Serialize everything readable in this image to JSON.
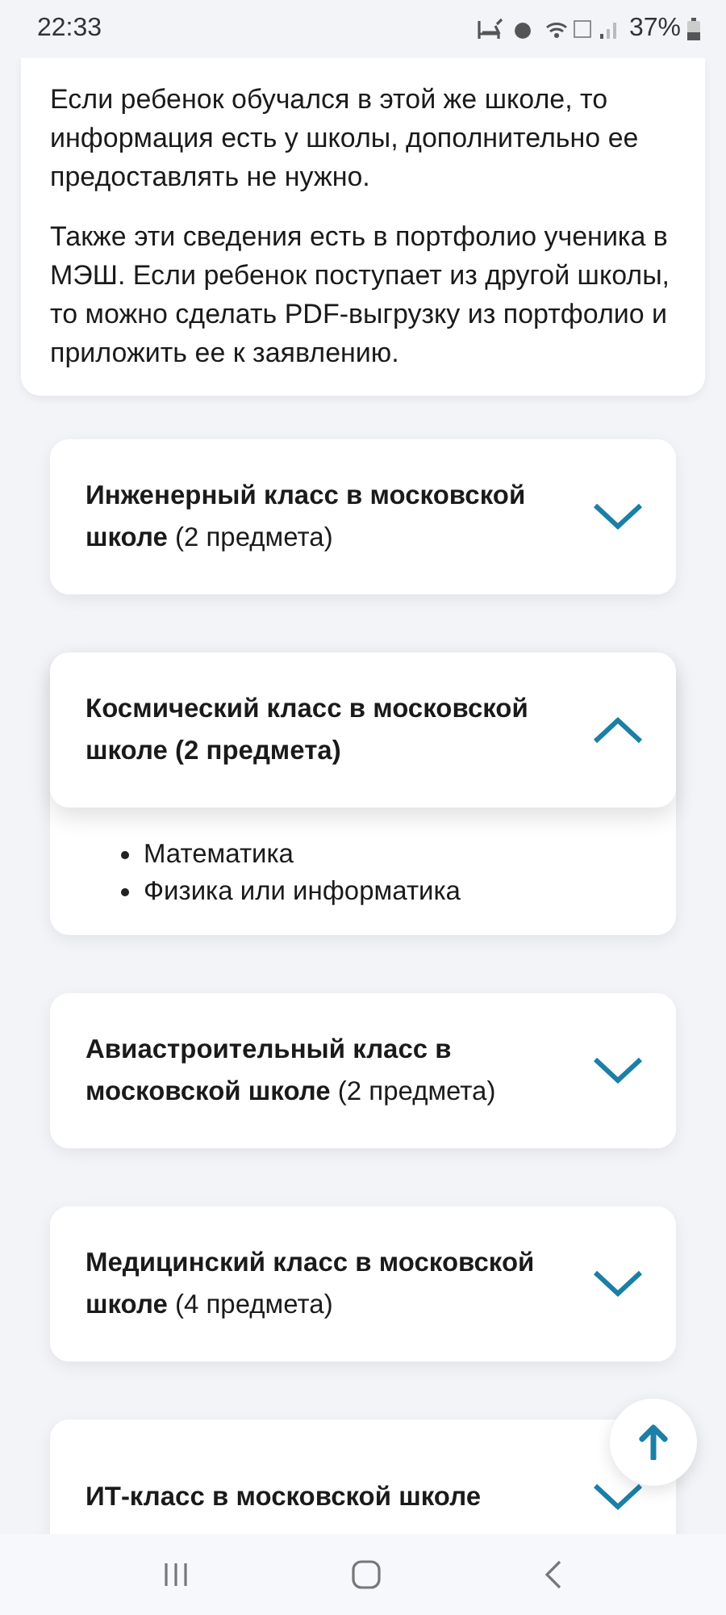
{
  "status_bar": {
    "time": "22:33",
    "battery": "37%"
  },
  "info_card": {
    "paragraphs": [
      "Если ребенок обучался в этой же школе, то информация есть у школы, дополнительно ее предоставлять не нужно.",
      "Также эти сведения есть в портфолио ученика в МЭШ. Если ребенок поступает из другой школы, то можно сделать PDF-выгрузку из портфолио и приложить ее к заявлению."
    ]
  },
  "accordion": [
    {
      "title": "**Инженерный класс в московской школе** (2 предмета)",
      "expanded": false
    },
    {
      "title": "Космический класс в московской школе (2 предмета)",
      "expanded": true,
      "items": [
        "Математика",
        "Физика или информатика"
      ]
    },
    {
      "title": "**Авиастроительный класс в московской школе** (2 предмета)",
      "expanded": false
    },
    {
      "title": "**Медицинский класс в московской школе** (4 предмета)",
      "expanded": false
    },
    {
      "title": "**ИТ-класс в московской школе**",
      "expanded": false
    }
  ]
}
